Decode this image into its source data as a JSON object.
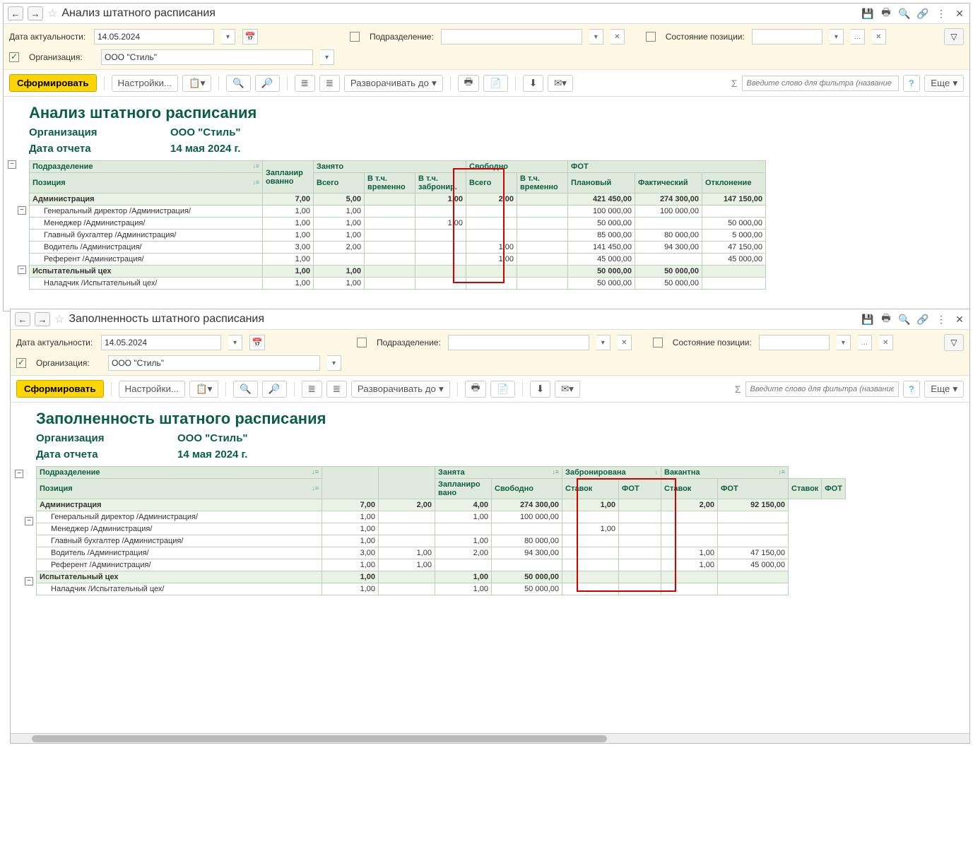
{
  "window1": {
    "title": "Анализ штатного расписания",
    "filters": {
      "date_label": "Дата актуальности:",
      "date_value": "14.05.2024",
      "org_label": "Организация:",
      "org_value": "ООО \"Стиль\"",
      "unit_label": "Подразделение:",
      "state_label": "Состояние позиции:"
    },
    "toolbar": {
      "generate": "Сформировать",
      "settings": "Настройки...",
      "expand": "Разворачивать до",
      "search_placeholder": "Введите слово для фильтра (название товара, покупателя и ...",
      "more": "Еще"
    },
    "report": {
      "title": "Анализ штатного расписания",
      "org_label": "Организация",
      "org_value": "ООО \"Стиль\"",
      "date_label": "Дата отчета",
      "date_value": "14 мая 2024 г.",
      "headers": {
        "unit": "Подразделение",
        "position": "Позиция",
        "planned": "Запланир\nованно",
        "busy": "Занято",
        "busy_total": "Всего",
        "busy_temp": "В т.ч.\nвременно",
        "busy_res": "В т.ч.\nзабронир.",
        "free": "Свободно",
        "free_total": "Всего",
        "free_temp": "В т.ч.\nвременно",
        "fot": "ФОТ",
        "fot_plan": "Плановый",
        "fot_fact": "Фактический",
        "fot_dev": "Отклонение"
      },
      "rows": [
        {
          "type": "grp",
          "name": "Администрация",
          "planned": "7,00",
          "busy_total": "5,00",
          "busy_res": "1,00",
          "free_total": "2,00",
          "fot_plan": "421 450,00",
          "fot_fact": "274 300,00",
          "fot_dev": "147 150,00"
        },
        {
          "type": "pos",
          "name": "Генеральный директор /Администрация/",
          "planned": "1,00",
          "busy_total": "1,00",
          "fot_plan": "100 000,00",
          "fot_fact": "100 000,00"
        },
        {
          "type": "pos",
          "name": "Менеджер /Администрация/",
          "planned": "1,00",
          "busy_total": "1,00",
          "busy_res": "1,00",
          "fot_plan": "50 000,00",
          "fot_dev": "50 000,00"
        },
        {
          "type": "pos",
          "name": "Главный бухгалтер /Администрация/",
          "planned": "1,00",
          "busy_total": "1,00",
          "fot_plan": "85 000,00",
          "fot_fact": "80 000,00",
          "fot_dev": "5 000,00"
        },
        {
          "type": "pos",
          "name": "Водитель /Администрация/",
          "planned": "3,00",
          "busy_total": "2,00",
          "free_total": "1,00",
          "fot_plan": "141 450,00",
          "fot_fact": "94 300,00",
          "fot_dev": "47 150,00"
        },
        {
          "type": "pos",
          "name": "Референт /Администрация/",
          "planned": "1,00",
          "free_total": "1,00",
          "fot_plan": "45 000,00",
          "fot_dev": "45 000,00"
        },
        {
          "type": "grp",
          "name": "Испытательный цех",
          "planned": "1,00",
          "busy_total": "1,00",
          "fot_plan": "50 000,00",
          "fot_fact": "50 000,00"
        },
        {
          "type": "pos",
          "name": "Наладчик /Испытательный цех/",
          "planned": "1,00",
          "busy_total": "1,00",
          "fot_plan": "50 000,00",
          "fot_fact": "50 000,00"
        }
      ]
    }
  },
  "window2": {
    "title": "Заполненность штатного расписания",
    "filters": {
      "date_label": "Дата актуальности:",
      "date_value": "14.05.2024",
      "org_label": "Организация:",
      "org_value": "ООО \"Стиль\"",
      "unit_label": "Подразделение:",
      "state_label": "Состояние позиции:"
    },
    "toolbar": {
      "generate": "Сформировать",
      "settings": "Настройки...",
      "expand": "Разворачивать до",
      "search_placeholder": "Введите слово для фильтра (название товара, покупателя и ...",
      "more": "Еще"
    },
    "report": {
      "title": "Заполненность штатного расписания",
      "org_label": "Организация",
      "org_value": "ООО \"Стиль\"",
      "date_label": "Дата отчета",
      "date_value": "14 мая 2024 г.",
      "headers": {
        "unit": "Подразделение",
        "position": "Позиция",
        "planned": "Запланиро\nвано",
        "free": "Свободно",
        "occ": "Занята",
        "occ_st": "Ставок",
        "occ_fot": "ФОТ",
        "res": "Забронирована",
        "res_st": "Ставок",
        "res_fot": "ФОТ",
        "vac": "Вакантна",
        "vac_st": "Ставок",
        "vac_fot": "ФОТ"
      },
      "rows": [
        {
          "type": "grp",
          "name": "Администрация",
          "planned": "7,00",
          "free": "2,00",
          "occ_st": "4,00",
          "occ_fot": "274 300,00",
          "res_st": "1,00",
          "vac_st": "2,00",
          "vac_fot": "92 150,00"
        },
        {
          "type": "pos",
          "name": "Генеральный директор /Администрация/",
          "planned": "1,00",
          "occ_st": "1,00",
          "occ_fot": "100 000,00"
        },
        {
          "type": "pos",
          "name": "Менеджер /Администрация/",
          "planned": "1,00",
          "res_st": "1,00"
        },
        {
          "type": "pos",
          "name": "Главный бухгалтер /Администрация/",
          "planned": "1,00",
          "occ_st": "1,00",
          "occ_fot": "80 000,00"
        },
        {
          "type": "pos",
          "name": "Водитель /Администрация/",
          "planned": "3,00",
          "free": "1,00",
          "occ_st": "2,00",
          "occ_fot": "94 300,00",
          "vac_st": "1,00",
          "vac_fot": "47 150,00"
        },
        {
          "type": "pos",
          "name": "Референт /Администрация/",
          "planned": "1,00",
          "free": "1,00",
          "vac_st": "1,00",
          "vac_fot": "45 000,00"
        },
        {
          "type": "grp",
          "name": "Испытательный цех",
          "planned": "1,00",
          "occ_st": "1,00",
          "occ_fot": "50 000,00"
        },
        {
          "type": "pos",
          "name": "Наладчик /Испытательный цех/",
          "planned": "1,00",
          "occ_st": "1,00",
          "occ_fot": "50 000,00"
        }
      ]
    }
  }
}
